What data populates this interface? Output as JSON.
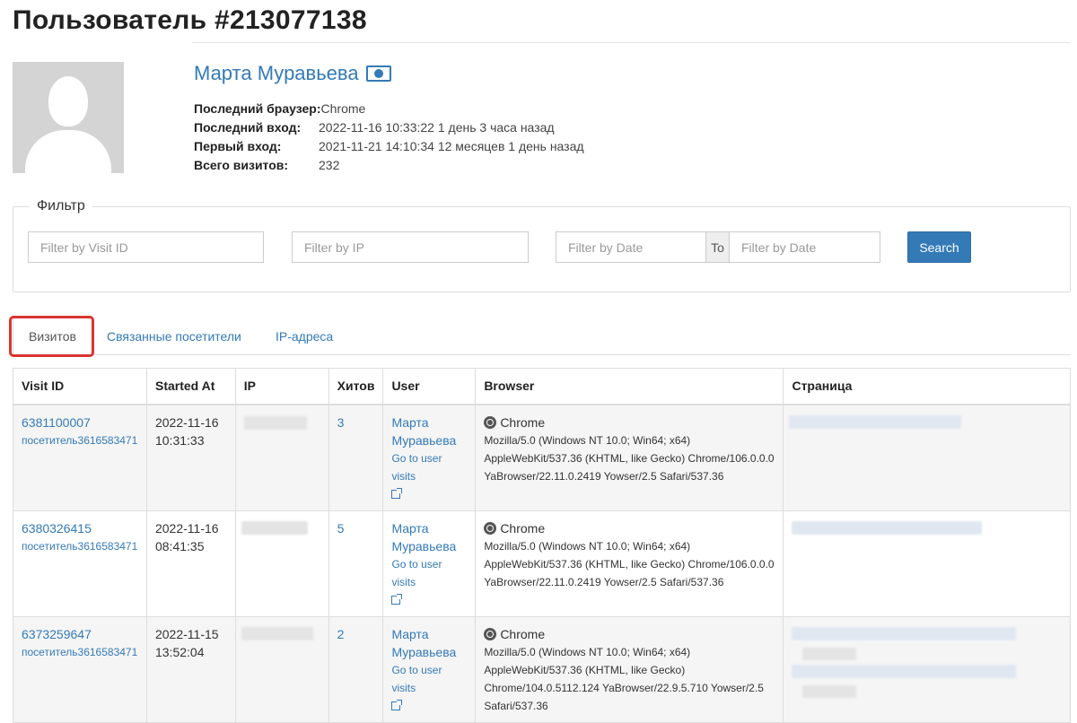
{
  "page": {
    "title": "Пользователь #213077138"
  },
  "profile": {
    "name": "Марта Муравьева",
    "fields": [
      {
        "label": "Последний браузер:",
        "value": "Chrome"
      },
      {
        "label": "Последний вход:",
        "value": "2022-11-16 10:33:22 1 день 3 часа назад"
      },
      {
        "label": "Первый вход:",
        "value": "2021-11-21 14:10:34 12 месяцев 1 день назад"
      },
      {
        "label": "Всего визитов:",
        "value": "232"
      }
    ]
  },
  "filter": {
    "legend": "Фильтр",
    "visit_id_placeholder": "Filter by Visit ID",
    "ip_placeholder": "Filter by IP",
    "date_from_placeholder": "Filter by Date",
    "to_label": "To",
    "date_to_placeholder": "Filter by Date",
    "search_label": "Search"
  },
  "tabs": [
    {
      "label": "Визитов",
      "active": true
    },
    {
      "label": "Связанные посетители",
      "active": false
    },
    {
      "label": "IP-адреса",
      "active": false
    }
  ],
  "table": {
    "columns": [
      "Visit ID",
      "Started At",
      "IP",
      "Хитов",
      "User",
      "Browser",
      "Страница"
    ],
    "rows": [
      {
        "visit_id": "6381100007",
        "visitor": "посетитель3616583471",
        "date": "2022-11-16",
        "time": "10:31:33",
        "hits": "3",
        "user_first": "Марта",
        "user_last": "Муравьева",
        "user_link": "Go to user visits",
        "browser": "Chrome",
        "ua_lines": [
          "Mozilla/5.0 (Windows NT 10.0; Win64; x64)",
          "AppleWebKit/537.36 (KHTML, like Gecko) Chrome/106.0.0.0",
          "YaBrowser/22.11.0.2419 Yowser/2.5 Safari/537.36"
        ]
      },
      {
        "visit_id": "6380326415",
        "visitor": "посетитель3616583471",
        "date": "2022-11-16",
        "time": "08:41:35",
        "hits": "5",
        "user_first": "Марта",
        "user_last": "Муравьева",
        "user_link": "Go to user visits",
        "browser": "Chrome",
        "ua_lines": [
          "Mozilla/5.0 (Windows NT 10.0; Win64; x64)",
          "AppleWebKit/537.36 (KHTML, like Gecko) Chrome/106.0.0.0",
          "YaBrowser/22.11.0.2419 Yowser/2.5 Safari/537.36"
        ]
      },
      {
        "visit_id": "6373259647",
        "visitor": "посетитель3616583471",
        "date": "2022-11-15",
        "time": "13:52:04",
        "hits": "2",
        "user_first": "Марта",
        "user_last": "Муравьева",
        "user_link": "Go to user visits",
        "browser": "Chrome",
        "ua_lines": [
          "Mozilla/5.0 (Windows NT 10.0; Win64; x64)",
          "AppleWebKit/537.36 (KHTML, like Gecko)",
          "Chrome/104.0.5112.124 YaBrowser/22.9.5.710 Yowser/2.5",
          "Safari/537.36"
        ]
      }
    ]
  },
  "colors": {
    "link": "#337ab7",
    "highlight": "#d9352f",
    "button": "#337ab7"
  }
}
